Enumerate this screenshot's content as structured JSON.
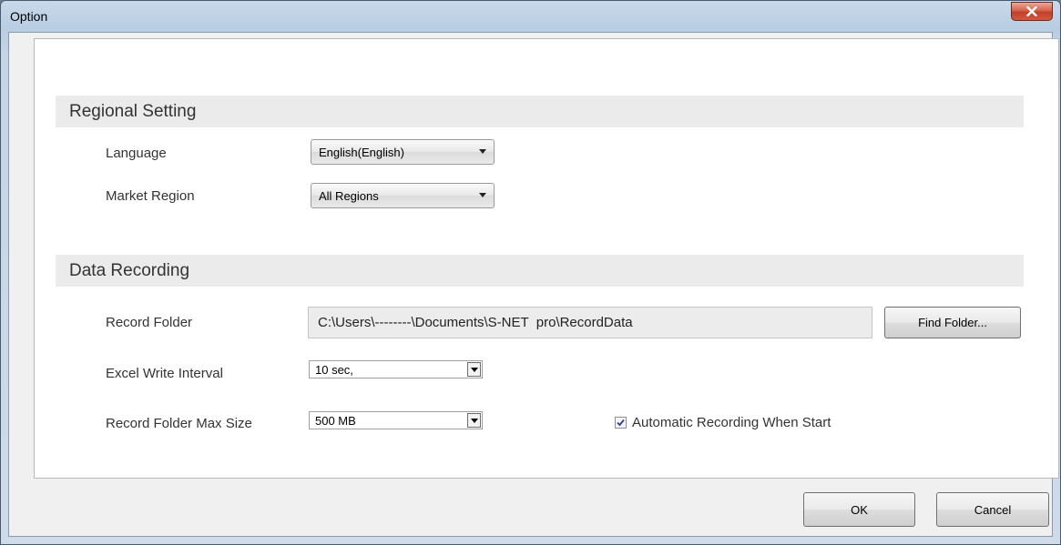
{
  "window": {
    "title": "Option",
    "close_icon": "close-x-icon"
  },
  "regional": {
    "header": "Regional Setting",
    "language_label": "Language",
    "language_value": "English(English)",
    "market_region_label": "Market Region",
    "market_region_value": "All Regions"
  },
  "recording": {
    "header": "Data Recording",
    "record_folder_label": "Record Folder",
    "record_folder_path": "C:\\Users\\--------\\Documents\\S-NET  pro\\RecordData",
    "find_folder_label": "Find Folder...",
    "excel_interval_label": "Excel Write Interval",
    "excel_interval_value": "10 sec,",
    "max_size_label": "Record Folder Max Size",
    "max_size_value": "500 MB",
    "auto_record_label": "Automatic Recording When Start",
    "auto_record_checked": true
  },
  "footer": {
    "ok_label": "OK",
    "cancel_label": "Cancel"
  }
}
